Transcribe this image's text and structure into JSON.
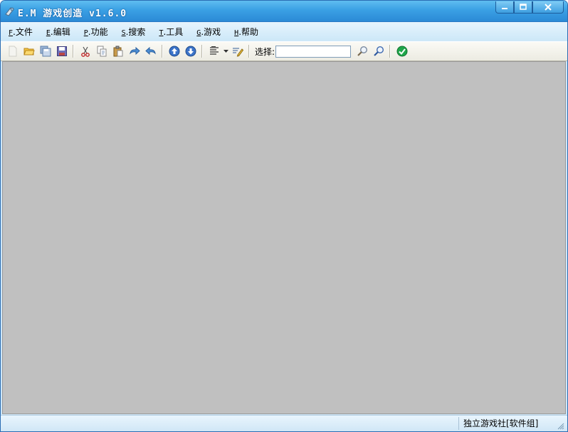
{
  "window": {
    "title": "E.M 游戏创造 v1.6.0",
    "controls": {
      "minimize_icon": "minimize-icon",
      "maximize_icon": "maximize-icon",
      "close_icon": "close-icon"
    }
  },
  "menu": [
    {
      "key": "F",
      "label": ".文件"
    },
    {
      "key": "E",
      "label": ".编辑"
    },
    {
      "key": "P",
      "label": ".功能"
    },
    {
      "key": "S",
      "label": ".搜索"
    },
    {
      "key": "T",
      "label": ".工具"
    },
    {
      "key": "G",
      "label": ".游戏"
    },
    {
      "key": "H",
      "label": ".帮助"
    }
  ],
  "toolbar": {
    "select_label": "选择:",
    "select_value": "",
    "icons": [
      "new-file-icon",
      "open-folder-icon",
      "save-all-icon",
      "save-icon",
      "cut-icon",
      "copy-icon",
      "paste-icon",
      "redo-icon",
      "undo-icon",
      "arrow-up-icon",
      "arrow-down-icon",
      "align-icon",
      "dropdown-icon",
      "edit-icon",
      "search-icon",
      "search-next-icon",
      "confirm-check-icon"
    ]
  },
  "status": {
    "text": "独立游戏社[软件组]"
  },
  "colors": {
    "titlebar": "#3aa0e4",
    "client": "#c0c0c0",
    "confirm": "#1fa64a"
  }
}
